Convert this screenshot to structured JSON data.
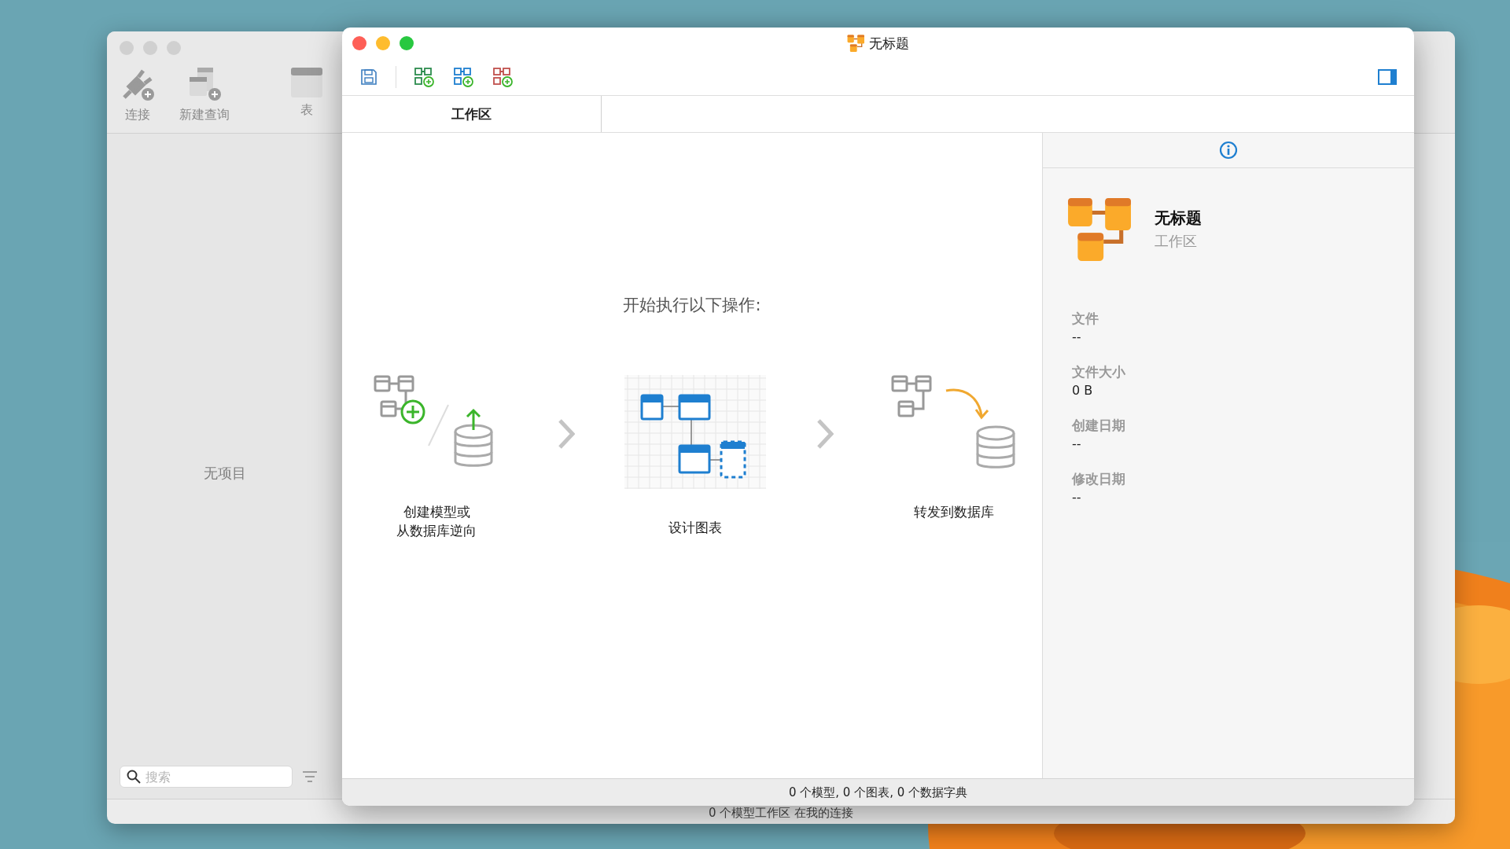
{
  "back_window": {
    "toolbar": [
      {
        "kind": "connect",
        "label": "连接"
      },
      {
        "kind": "query",
        "label": "新建查询"
      },
      {
        "kind": "table",
        "label": "表"
      }
    ],
    "empty_text": "无项目",
    "search": {
      "placeholder": "搜索"
    },
    "status": "0 个模型工作区 在我的连接"
  },
  "window": {
    "title": "无标题",
    "tabs": [
      {
        "label": "工作区",
        "selected": true
      }
    ],
    "intro": "开始执行以下操作:",
    "steps": [
      {
        "kind": "create",
        "lines": [
          "创建模型或",
          "从数据库逆向"
        ]
      },
      {
        "kind": "design",
        "lines": [
          "设计图表"
        ]
      },
      {
        "kind": "forward",
        "lines": [
          "转发到数据库"
        ]
      }
    ],
    "info": {
      "name": "无标题",
      "type": "工作区",
      "fields": [
        {
          "label": "文件",
          "value": "--"
        },
        {
          "label": "文件大小",
          "value": "0 B"
        },
        {
          "label": "创建日期",
          "value": "--"
        },
        {
          "label": "修改日期",
          "value": "--"
        }
      ]
    },
    "status_bar": "0 个模型, 0 个图表, 0 个数据字典"
  }
}
